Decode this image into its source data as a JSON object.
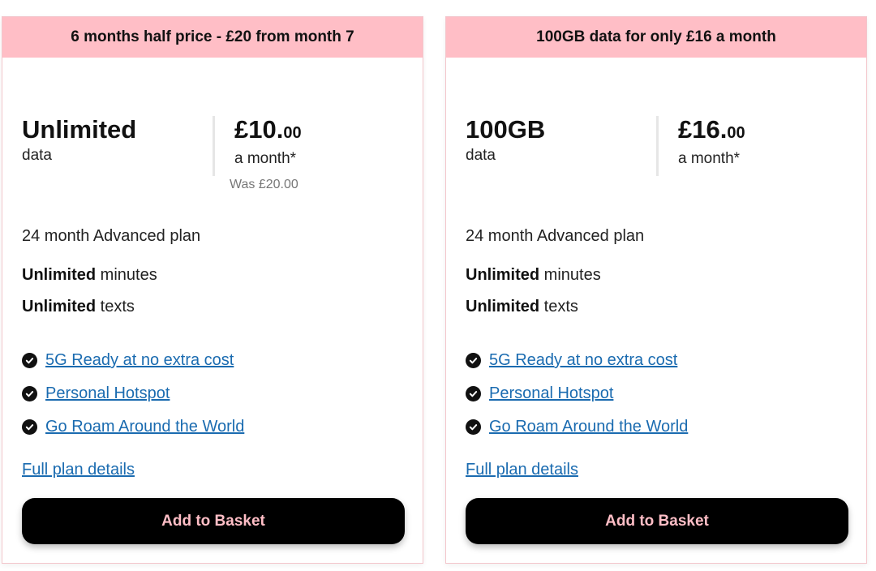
{
  "plans": [
    {
      "banner": "6 months half price - £20 from month 7",
      "data_amount": "Unlimited",
      "data_unit": "data",
      "price_pounds": "£10.",
      "price_pence": "00",
      "price_period": "a month*",
      "was_price": "Was £20.00",
      "plan_name": "24 month Advanced plan",
      "minutes_bold": "Unlimited",
      "minutes_text": " minutes",
      "texts_bold": "Unlimited",
      "texts_text": " texts",
      "features": [
        "5G Ready at no extra cost",
        "Personal Hotspot",
        "Go Roam Around the World"
      ],
      "full_details_label": "Full plan details",
      "basket_label": "Add to Basket"
    },
    {
      "banner": "100GB data for only £16 a month",
      "data_amount": "100GB",
      "data_unit": "data",
      "price_pounds": "£16.",
      "price_pence": "00",
      "price_period": "a month*",
      "was_price": "",
      "plan_name": "24 month Advanced plan",
      "minutes_bold": "Unlimited",
      "minutes_text": " minutes",
      "texts_bold": "Unlimited",
      "texts_text": " texts",
      "features": [
        "5G Ready at no extra cost",
        "Personal Hotspot",
        "Go Roam Around the World"
      ],
      "full_details_label": "Full plan details",
      "basket_label": "Add to Basket"
    }
  ],
  "colors": {
    "banner_bg": "#ffbec6",
    "link": "#1a6bb0",
    "button_bg": "#000000",
    "button_text": "#ffbec6"
  },
  "icons": {
    "feature_check": "check-circle-icon"
  }
}
